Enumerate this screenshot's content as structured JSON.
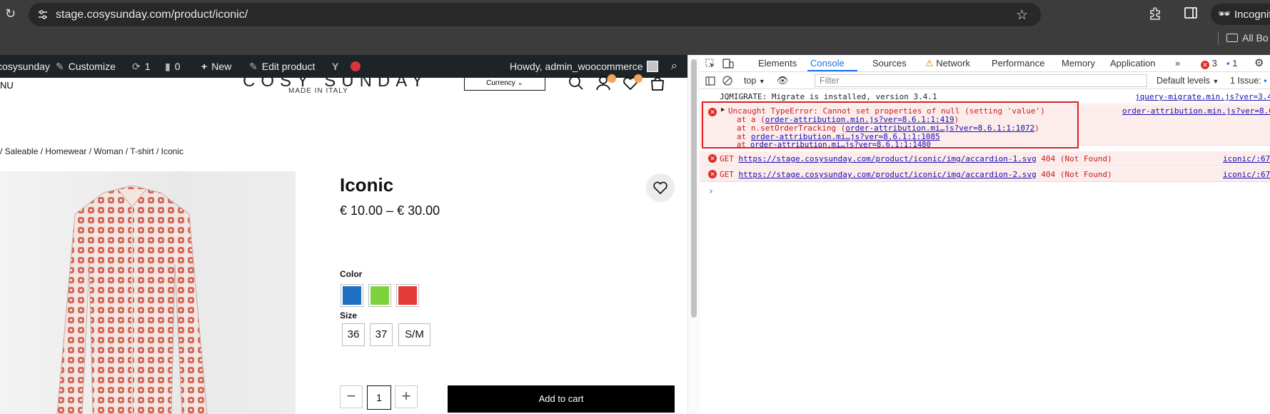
{
  "browser": {
    "url": "stage.cosysunday.com/product/iconic/",
    "profile_label": "Incognito",
    "bookmarks_label": "All Bo"
  },
  "adminbar": {
    "site_name": "cosysunday",
    "customize": "Customize",
    "updates_count": "1",
    "comments_count": "0",
    "new_label": "New",
    "edit_label": "Edit product",
    "howdy": "Howdy, admin_woocommerce"
  },
  "header": {
    "menu_fragment": "NU",
    "brand": "COSY SUNDAY",
    "tagline": "MADE IN ITALY",
    "currency_label": "Currency"
  },
  "breadcrumb": "/ Saleable / Homewear / Woman / T-shirt / Iconic",
  "product": {
    "title": "Iconic",
    "price": "€ 10.00 – € 30.00",
    "color_label": "Color",
    "colors": [
      "#1f6fc2",
      "#7ed13b",
      "#e23a36"
    ],
    "size_label": "Size",
    "sizes": [
      "36",
      "37",
      "S/M"
    ],
    "quantity": "1",
    "add_to_cart": "Add to cart"
  },
  "devtools": {
    "tabs": [
      "Elements",
      "Console",
      "Sources",
      "Network",
      "Performance",
      "Memory",
      "Application"
    ],
    "active_tab": "Console",
    "error_count": "3",
    "issue_count": "1",
    "context": "top",
    "filter_placeholder": "Filter",
    "levels": "Default levels",
    "issues_label": "1 Issue:",
    "messages": [
      {
        "type": "log",
        "text": "JQMIGRATE: Migrate is installed, version 3.4.1",
        "source": "jquery-migrate.min.js?ver=3.4"
      },
      {
        "type": "error",
        "text": "Uncaught TypeError: Cannot set properties of null (setting 'value')",
        "source": "order-attribution.min.js?ver=8.6",
        "stack": [
          {
            "prefix": "at a (",
            "link": "order-attribution.min.js?ver=8.6.1:1:419",
            "suffix": ")"
          },
          {
            "prefix": "at n.setOrderTracking (",
            "link": "order-attribution.mi…js?ver=8.6.1:1:1072",
            "suffix": ")"
          },
          {
            "prefix": "at ",
            "link": "order-attribution.mi…js?ver=8.6.1:1:1085",
            "suffix": ""
          },
          {
            "prefix": "at ",
            "link": "order-attribution.mi…js?ver=8.6.1:1:1480",
            "suffix": ""
          }
        ]
      },
      {
        "type": "error",
        "method": "GET",
        "url": "https://stage.cosysunday.com/product/iconic/img/accardion-1.svg",
        "status": "404 (Not Found)",
        "source": "iconic/:67"
      },
      {
        "type": "error",
        "method": "GET",
        "url": "https://stage.cosysunday.com/product/iconic/img/accardion-2.svg",
        "status": "404 (Not Found)",
        "source": "iconic/:67"
      }
    ]
  }
}
